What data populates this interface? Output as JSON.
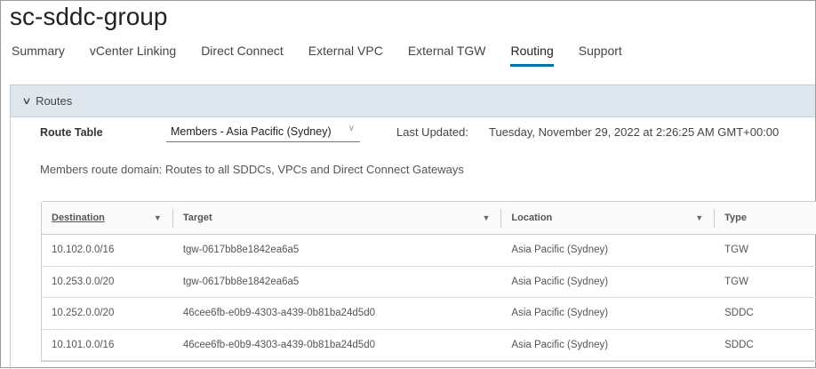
{
  "title": "sc-sddc-group",
  "tabs": [
    "Summary",
    "vCenter Linking",
    "Direct Connect",
    "External VPC",
    "External TGW",
    "Routing",
    "Support"
  ],
  "active_tab": "Routing",
  "panel": {
    "title": "Routes",
    "route_table_label": "Route Table",
    "route_table_value": "Members - Asia Pacific (Sydney)",
    "last_updated_label": "Last Updated:",
    "last_updated_value": "Tuesday, November 29, 2022 at 2:26:25 AM GMT+00:00",
    "description": "Members route domain: Routes to all SDDCs, VPCs and Direct Connect Gateways"
  },
  "table": {
    "columns": [
      "Destination",
      "Target",
      "Location",
      "Type"
    ],
    "rows": [
      [
        "10.102.0.0/16",
        "tgw-0617bb8e1842ea6a5",
        "Asia Pacific (Sydney)",
        "TGW"
      ],
      [
        "10.253.0.0/20",
        "tgw-0617bb8e1842ea6a5",
        "Asia Pacific (Sydney)",
        "TGW"
      ],
      [
        "10.252.0.0/20",
        "46cee6fb-e0b9-4303-a439-0b81ba24d5d0",
        "Asia Pacific (Sydney)",
        "SDDC"
      ],
      [
        "10.101.0.0/16",
        "46cee6fb-e0b9-4303-a439-0b81ba24d5d0",
        "Asia Pacific (Sydney)",
        "SDDC"
      ]
    ]
  }
}
